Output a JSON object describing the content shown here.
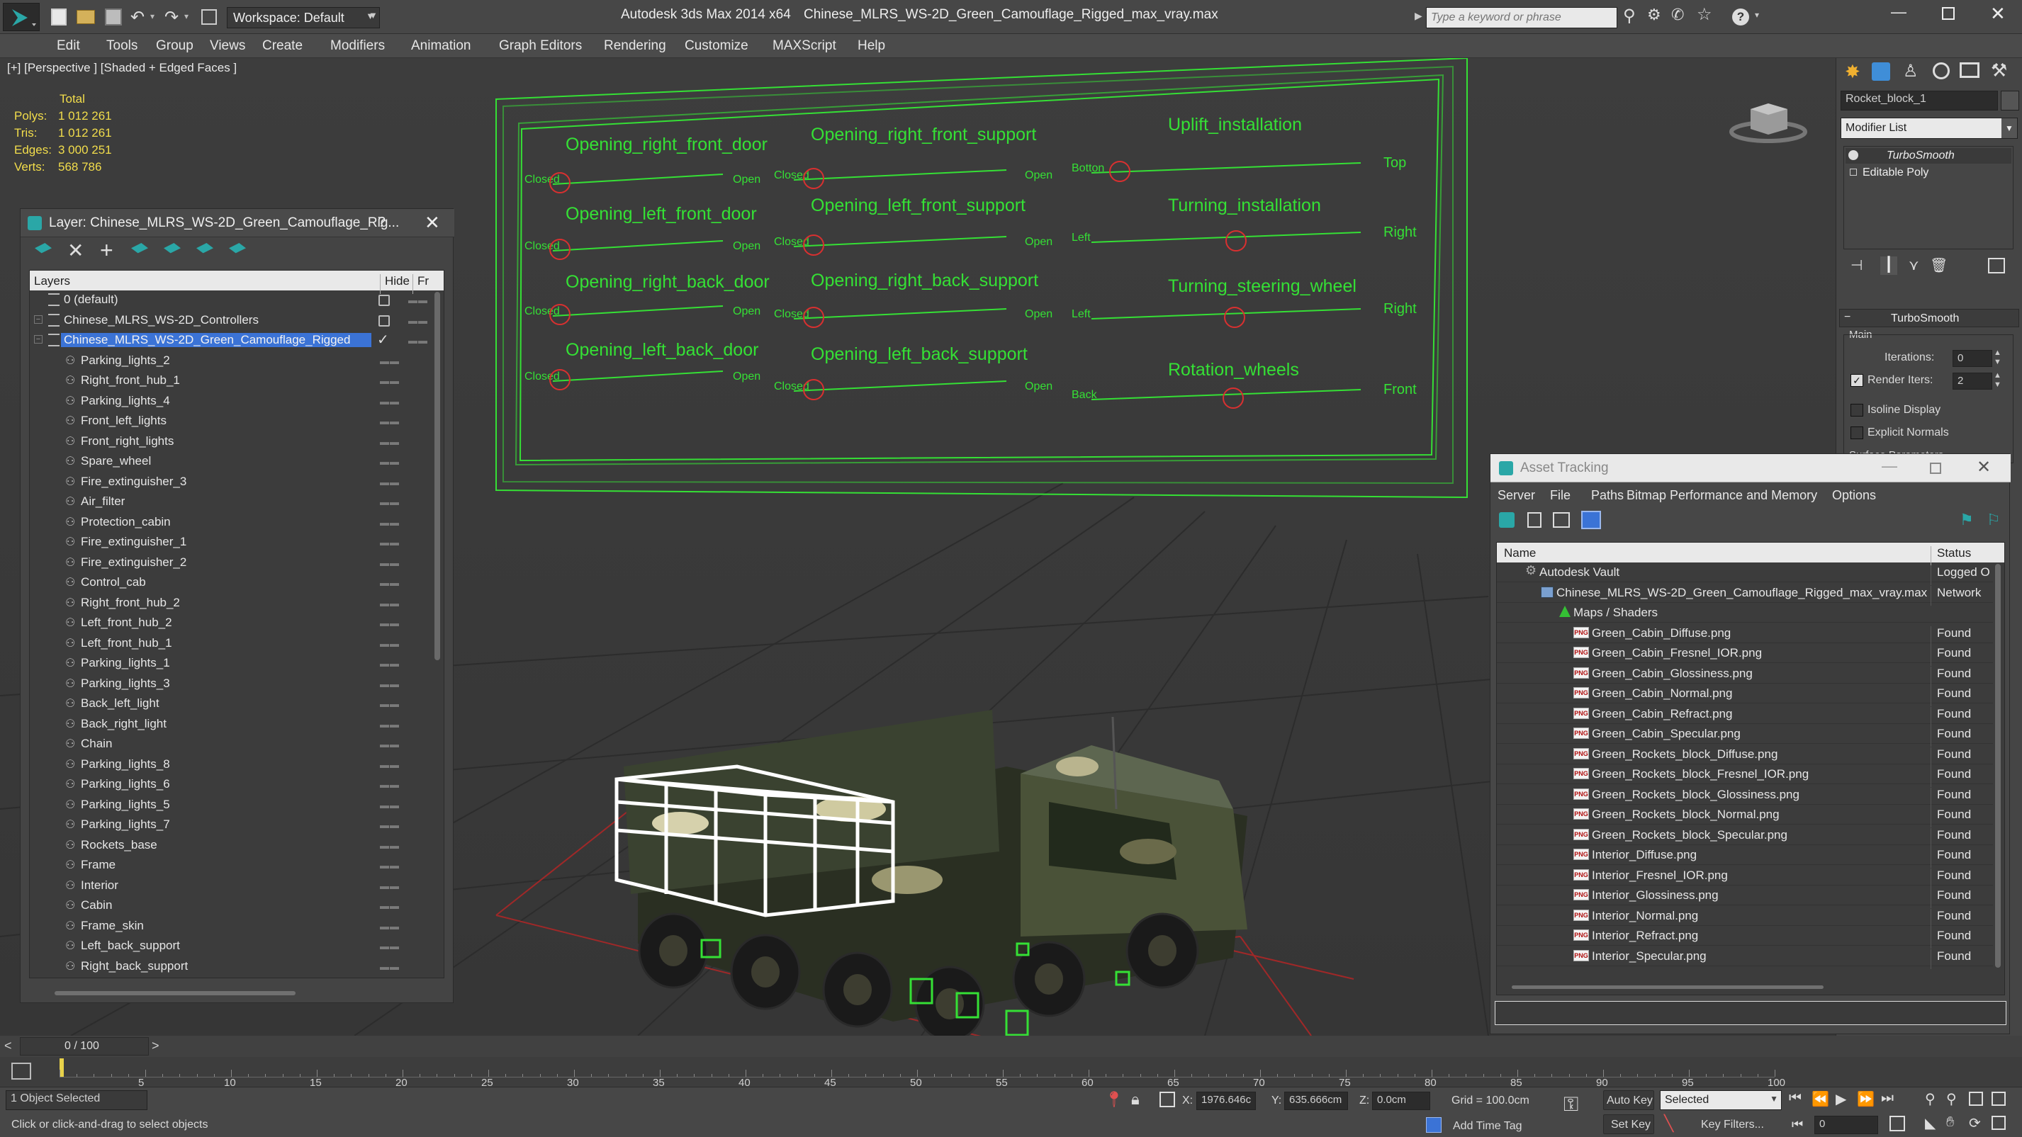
{
  "app": {
    "title": "Autodesk 3ds Max  2014 x64",
    "file": "Chinese_MLRS_WS-2D_Green_Camouflage_Rigged_max_vray.max",
    "workspace": "Workspace: Default",
    "search_placeholder": "Type a keyword or phrase"
  },
  "menu": [
    "Edit",
    "Tools",
    "Group",
    "Views",
    "Create",
    "Modifiers",
    "Animation",
    "Graph Editors",
    "Rendering",
    "Customize",
    "MAXScript",
    "Help"
  ],
  "viewport": {
    "label": "[+] [Perspective ] [Shaded + Edged Faces ]",
    "stats": {
      "total_label": "Total",
      "polys_label": "Polys:",
      "polys": "1 012 261",
      "tris_label": "Tris:",
      "tris": "1 012 261",
      "edges_label": "Edges:",
      "edges": "3 000 251",
      "verts_label": "Verts:",
      "verts": "568 786"
    }
  },
  "controls": {
    "col1": [
      {
        "title": "Opening_right_front_door",
        "left": "Closed",
        "right": "Open"
      },
      {
        "title": "Opening_left_front_door",
        "left": "Closed",
        "right": "Open"
      },
      {
        "title": "Opening_right_back_door",
        "left": "Closed",
        "right": "Open"
      },
      {
        "title": "Opening_left_back_door",
        "left": "Closed",
        "right": "Open"
      }
    ],
    "col2": [
      {
        "title": "Opening_right_front_support",
        "left": "Closed",
        "right": "Open"
      },
      {
        "title": "Opening_left_front_support",
        "left": "Closed",
        "right": "Open"
      },
      {
        "title": "Opening_right_back_support",
        "left": "Closed",
        "right": "Open"
      },
      {
        "title": "Opening_left_back_support",
        "left": "Closed",
        "right": "Open"
      }
    ],
    "col3": [
      {
        "title": "Uplift_installation",
        "left": "Botton",
        "right": "Top"
      },
      {
        "title": "Turning_installation",
        "left": "Left",
        "right": "Right"
      },
      {
        "title": "Turning_steering_wheel",
        "left": "Left",
        "right": "Right"
      },
      {
        "title": "Rotation_wheels",
        "left": "Back",
        "right": "Front"
      }
    ]
  },
  "layer_panel": {
    "title": "Layer: Chinese_MLRS_WS-2D_Green_Camouflage_Rig...",
    "help": "?",
    "col_layers": "Layers",
    "col_hide": "Hide",
    "col_fr": "Fr",
    "layers": [
      "0 (default)",
      "Chinese_MLRS_WS-2D_Controllers",
      "Chinese_MLRS_WS-2D_Green_Camouflage_Rigged"
    ],
    "objects": [
      "Parking_lights_2",
      "Right_front_hub_1",
      "Parking_lights_4",
      "Front_left_lights",
      "Front_right_lights",
      "Spare_wheel",
      "Fire_extinguisher_3",
      "Air_filter",
      "Protection_cabin",
      "Fire_extinguisher_1",
      "Fire_extinguisher_2",
      "Control_cab",
      "Right_front_hub_2",
      "Left_front_hub_2",
      "Left_front_hub_1",
      "Parking_lights_1",
      "Parking_lights_3",
      "Back_left_light",
      "Back_right_light",
      "Chain",
      "Parking_lights_8",
      "Parking_lights_6",
      "Parking_lights_5",
      "Parking_lights_7",
      "Rockets_base",
      "Frame",
      "Interior",
      "Cabin",
      "Frame_skin",
      "Left_back_support",
      "Right_back_support"
    ]
  },
  "asset_tracking": {
    "title": "Asset Tracking",
    "menu": [
      "Server",
      "File",
      "Paths",
      "Bitmap Performance and Memory",
      "Options"
    ],
    "col_name": "Name",
    "col_status": "Status",
    "vault": {
      "name": "Autodesk Vault",
      "status": "Logged O"
    },
    "file": {
      "name": "Chinese_MLRS_WS-2D_Green_Camouflage_Rigged_max_vray.max",
      "status": "Network"
    },
    "maps": "Maps / Shaders",
    "png_tag": "PNG",
    "files": [
      {
        "name": "Green_Cabin_Diffuse.png",
        "status": "Found"
      },
      {
        "name": "Green_Cabin_Fresnel_IOR.png",
        "status": "Found"
      },
      {
        "name": "Green_Cabin_Glossiness.png",
        "status": "Found"
      },
      {
        "name": "Green_Cabin_Normal.png",
        "status": "Found"
      },
      {
        "name": "Green_Cabin_Refract.png",
        "status": "Found"
      },
      {
        "name": "Green_Cabin_Specular.png",
        "status": "Found"
      },
      {
        "name": "Green_Rockets_block_Diffuse.png",
        "status": "Found"
      },
      {
        "name": "Green_Rockets_block_Fresnel_IOR.png",
        "status": "Found"
      },
      {
        "name": "Green_Rockets_block_Glossiness.png",
        "status": "Found"
      },
      {
        "name": "Green_Rockets_block_Normal.png",
        "status": "Found"
      },
      {
        "name": "Green_Rockets_block_Specular.png",
        "status": "Found"
      },
      {
        "name": "Interior_Diffuse.png",
        "status": "Found"
      },
      {
        "name": "Interior_Fresnel_IOR.png",
        "status": "Found"
      },
      {
        "name": "Interior_Glossiness.png",
        "status": "Found"
      },
      {
        "name": "Interior_Normal.png",
        "status": "Found"
      },
      {
        "name": "Interior_Refract.png",
        "status": "Found"
      },
      {
        "name": "Interior_Specular.png",
        "status": "Found"
      }
    ]
  },
  "command_panel": {
    "object_name": "Rocket_block_1",
    "modifier_list": "Modifier List",
    "stack": [
      "TurboSmooth",
      "Editable Poly"
    ],
    "rollout": "TurboSmooth",
    "main": "Main",
    "iterations_label": "Iterations:",
    "iterations": "0",
    "render_iters_label": "Render Iters:",
    "render_iters": "2",
    "isoline": "Isoline Display",
    "explicit": "Explicit Normals",
    "surface": "Surface Parameters"
  },
  "timeline": {
    "frame": "0 / 100",
    "prev": "<",
    "next": ">",
    "ticks": [
      "5",
      "10",
      "15",
      "20",
      "25",
      "30",
      "35",
      "40",
      "45",
      "50",
      "55",
      "60",
      "65",
      "70",
      "75",
      "80",
      "85",
      "90",
      "95",
      "100"
    ]
  },
  "status": {
    "selected": "1 Object Selected",
    "hint": "Click or click-and-drag to select objects",
    "x_label": "X:",
    "x": "1976.646c",
    "y_label": "Y:",
    "y": "635.666cm",
    "z_label": "Z:",
    "z": "0.0cm",
    "grid": "Grid = 100.0cm",
    "add_time_tag": "Add Time Tag",
    "auto_key": "Auto Key",
    "selected_option": "Selected",
    "set_key": "Set Key",
    "key_filters": "Key Filters...",
    "frame_field": "0"
  },
  "colors": {
    "selection": "#3b73d6",
    "wire_green": "#35e035",
    "handle_red": "#d93030"
  }
}
